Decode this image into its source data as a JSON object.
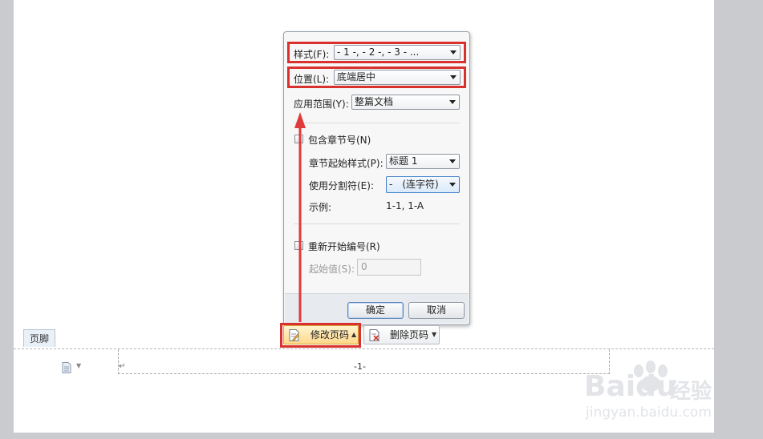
{
  "dialog": {
    "style": {
      "label": "样式(F):",
      "value": "- 1 -, - 2 -, - 3 - ..."
    },
    "position": {
      "label": "位置(L):",
      "value": "底端居中"
    },
    "scope": {
      "label": "应用范围(Y):",
      "value": "整篇文档"
    },
    "include_chapter": {
      "label": "包含章节号(N)",
      "checked": false
    },
    "chapter_style": {
      "label": "章节起始样式(P):",
      "value": "标题 1"
    },
    "separator": {
      "label": "使用分割符(E):",
      "value": "-　(连字符)"
    },
    "example": {
      "label": "示例:",
      "value": "1-1, 1-A"
    },
    "restart": {
      "label": "重新开始编号(R)",
      "checked": false
    },
    "start_value": {
      "label": "起始值(S):",
      "value": "0"
    },
    "ok_label": "确定",
    "cancel_label": "取消"
  },
  "toolbar": {
    "modify_label": "修改页码",
    "delete_label": "删除页码"
  },
  "document": {
    "footer_tag": "页脚",
    "return_mark": "↵",
    "page_number": "-1-"
  },
  "watermark": {
    "brand": "Baidu",
    "brand_cn": "经验",
    "url": "jingyan.baidu.com"
  },
  "colors": {
    "highlight": "#d9322e",
    "arrow": "#e03a3a",
    "active_button": "#ffd98a"
  }
}
